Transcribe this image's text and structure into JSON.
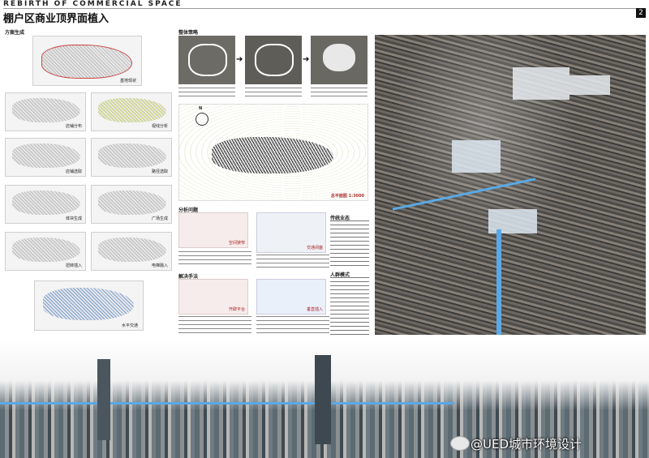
{
  "header": {
    "title_en": "REBIRTH OF COMMERCIAL SPACE",
    "title_cn": "棚户区商业顶界面植入",
    "page_number": "2"
  },
  "left_column": {
    "section_title": "方案生成",
    "site_label": "基地现状",
    "grid": [
      [
        "店铺分布",
        "视线分析"
      ],
      [
        "店铺选取",
        "路径选取"
      ],
      [
        "体块生成",
        "广场生成"
      ],
      [
        "扭转插入",
        "电梯融入"
      ]
    ],
    "bottom_label": "水平交通"
  },
  "middle_column": {
    "strategy_title": "整体策略",
    "plan_label": "总平面图 1:3000",
    "north": "N",
    "analysis_title": "分析问题",
    "analysis_labels": [
      "空间狭窄",
      "交通闭塞"
    ],
    "solution_title": "解决手法",
    "solution_labels": [
      "开辟平台",
      "垂直插入"
    ]
  },
  "right_text": {
    "heading1": "传统业态",
    "heading2": "人群模式"
  },
  "watermark": "@UED城市环境设计",
  "colors": {
    "accent_blue": "#5aa9e6",
    "header_black": "#111111",
    "panel_grey": "#f4f4f4"
  }
}
